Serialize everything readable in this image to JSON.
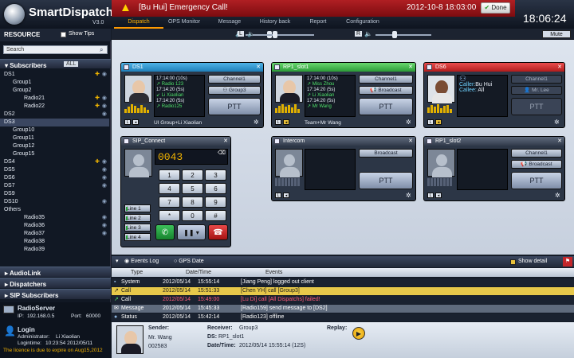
{
  "app": {
    "name": "SmartDispatch",
    "version": "V3.0",
    "clock": "18:06:24"
  },
  "alert": {
    "message": "[Bu Hui] Emergency Call!",
    "datetime": "2012-10-8 18:03:00",
    "done_label": "Done"
  },
  "nav": [
    "Dispatch",
    "OPS Monitor",
    "Message",
    "History back",
    "Report",
    "Configuration"
  ],
  "sidebar": {
    "resource_title": "RESOURCE",
    "show_tips": "Show Tips",
    "search_placeholder": "Search",
    "subscribers_title": "Subscribers",
    "all_label": "ALL",
    "tree": [
      "DS1",
      "Group1",
      "Group2",
      "Radio21",
      "Radio22",
      "DS2",
      "DS3",
      "Group10",
      "Group11",
      "Group12",
      "Group15",
      "DS4",
      "DS5",
      "DS6",
      "DS7",
      "DS9",
      "DS10",
      "Others",
      "Radio35",
      "Radio36",
      "Radio37",
      "Radio38",
      "Radio39"
    ],
    "sections": [
      "AudioLink",
      "Dispatchers",
      "SIP Subscribers"
    ],
    "radio_server": {
      "title": "RadioServer",
      "ip_label": "IP:",
      "ip": "192.168.0.5",
      "port_label": "Port:",
      "port": "60000"
    },
    "login": {
      "title": "Login",
      "admin_label": "Administrator:",
      "admin": "Li Xiaolian",
      "logintime_label": "Logintime:",
      "logintime": "10:23:54 2012/05/11",
      "license": "The licence is due to expire on Aug15,2012"
    }
  },
  "toolbar": {
    "mute_label": "Mute",
    "l_label": "L",
    "r_label": "R"
  },
  "cards": {
    "ds1": {
      "title": "DS1",
      "lines": [
        "17:14:00 (10s)",
        "Radio 123",
        "17:14:20 (5s)",
        "Li Xiaolian",
        "17:14:20 (5s)",
        "Radio125"
      ],
      "ch1": "Channel1",
      "ch2": "Group3",
      "ptt": "PTT",
      "foot": "UI Group+Li Xiaolian"
    },
    "rp1": {
      "title": "RP1_slot1",
      "lines": [
        "17:14:00 (10s)",
        "Miss Zhou",
        "17:14:20 (5s)",
        "Li Xiaolian",
        "17:14:20 (5s)",
        "Mr Wang"
      ],
      "ch1": "Channel1",
      "ch2": "Broadcast",
      "ptt": "PTT",
      "foot": "Team+Mr Wang"
    },
    "ds6": {
      "title": "DS6",
      "caller_label": "Caller:",
      "caller": "Bu Hui",
      "callee_label": "Callee:",
      "callee": "All",
      "ch1": "Channel1",
      "ch2": "Mr. Lee",
      "ptt": "PTT"
    },
    "sip": {
      "title": "SIP_Connect",
      "number": "0043",
      "keys": [
        "1",
        "2",
        "3",
        "4",
        "5",
        "6",
        "7",
        "8",
        "9",
        "*",
        "0",
        "#"
      ],
      "lines": [
        "Line 1",
        "Line 2",
        "Line 3",
        "Line 4"
      ]
    },
    "intercom": {
      "title": "Intercom",
      "ch1": "Broadcast",
      "ptt": "PTT"
    },
    "rp1s2": {
      "title": "RP1_slot2",
      "ch1": "Channel1",
      "ch2": "Broadcast",
      "ptt": "PTT"
    }
  },
  "events": {
    "tab1": "Events Log",
    "tab2": "GPS Date",
    "show_detail": "Show detail",
    "headers": [
      "Type",
      "Date/Time",
      "Events"
    ],
    "rows": [
      {
        "type": "System",
        "date": "2012/05/14",
        "time": "15:55:14",
        "event": "[Jiang Peng] logged out client",
        "color": "#1a2230"
      },
      {
        "type": "Call",
        "date": "2012/05/14",
        "time": "15:51:33",
        "event": "[Chen YH] call [Group3]",
        "color": "#e7c84a"
      },
      {
        "type": "Call",
        "date": "2012/05/14",
        "time": "15:49:00",
        "event": "[Lu Di] call [All Dispatchs] failed!",
        "color": "#1a2230",
        "red": true
      },
      {
        "type": "Message",
        "date": "2012/05/14",
        "time": "15:45:33",
        "event": "[Radio159] send message to [DS2]",
        "color": "#5f6b7d"
      },
      {
        "type": "Status",
        "date": "2012/05/14",
        "time": "15:42:14",
        "event": "[Radio123] offline",
        "color": "#1a2230"
      }
    ]
  },
  "sender": {
    "sender_label": "Sender:",
    "sender": "Mr. Wang",
    "id": "002583",
    "receiver_label": "Receiver:",
    "receiver": "Group3",
    "ds_label": "DS:",
    "ds": "RP1_slot1",
    "dt_label": "Date/Time:",
    "datetime": "2012/05/14 15:55:14 (12S)",
    "replay_label": "Replay:"
  }
}
